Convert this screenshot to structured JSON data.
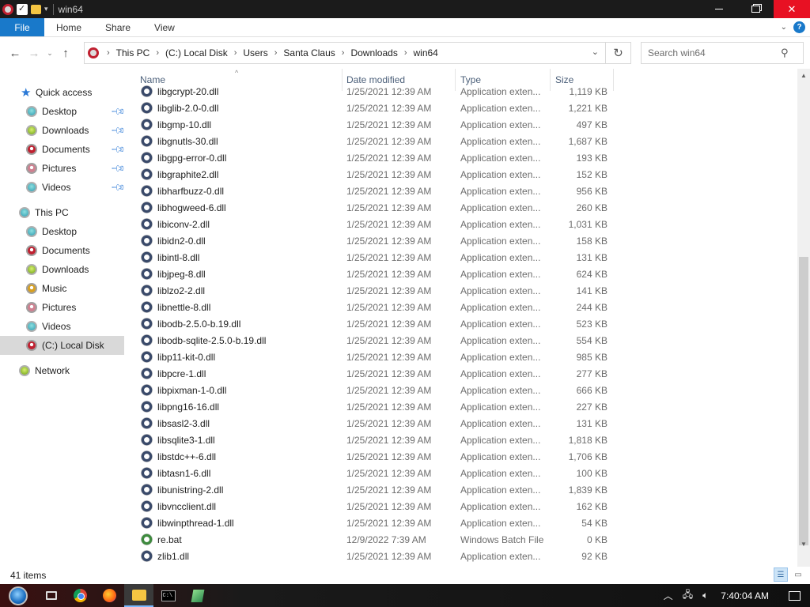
{
  "window": {
    "title": "win64"
  },
  "ribbon": {
    "tabs": [
      "File",
      "Home",
      "Share",
      "View"
    ]
  },
  "address": {
    "crumbs": [
      "This PC",
      "(C:) Local Disk",
      "Users",
      "Santa Claus",
      "Downloads",
      "win64"
    ]
  },
  "search": {
    "placeholder": "Search win64"
  },
  "nav": {
    "quick_access": "Quick access",
    "quick_items": [
      "Desktop",
      "Downloads",
      "Documents",
      "Pictures",
      "Videos"
    ],
    "this_pc": "This PC",
    "pc_items": [
      "Desktop",
      "Documents",
      "Downloads",
      "Music",
      "Pictures",
      "Videos",
      "(C:) Local Disk"
    ],
    "network": "Network"
  },
  "columns": {
    "name": "Name",
    "date": "Date modified",
    "type": "Type",
    "size": "Size"
  },
  "files": [
    {
      "name": "libgcrypt-20.dll",
      "date": "1/25/2021 12:39 AM",
      "type": "Application exten...",
      "size": "1,119 KB",
      "icon": "dll"
    },
    {
      "name": "libglib-2.0-0.dll",
      "date": "1/25/2021 12:39 AM",
      "type": "Application exten...",
      "size": "1,221 KB",
      "icon": "dll"
    },
    {
      "name": "libgmp-10.dll",
      "date": "1/25/2021 12:39 AM",
      "type": "Application exten...",
      "size": "497 KB",
      "icon": "dll"
    },
    {
      "name": "libgnutls-30.dll",
      "date": "1/25/2021 12:39 AM",
      "type": "Application exten...",
      "size": "1,687 KB",
      "icon": "dll"
    },
    {
      "name": "libgpg-error-0.dll",
      "date": "1/25/2021 12:39 AM",
      "type": "Application exten...",
      "size": "193 KB",
      "icon": "dll"
    },
    {
      "name": "libgraphite2.dll",
      "date": "1/25/2021 12:39 AM",
      "type": "Application exten...",
      "size": "152 KB",
      "icon": "dll"
    },
    {
      "name": "libharfbuzz-0.dll",
      "date": "1/25/2021 12:39 AM",
      "type": "Application exten...",
      "size": "956 KB",
      "icon": "dll"
    },
    {
      "name": "libhogweed-6.dll",
      "date": "1/25/2021 12:39 AM",
      "type": "Application exten...",
      "size": "260 KB",
      "icon": "dll"
    },
    {
      "name": "libiconv-2.dll",
      "date": "1/25/2021 12:39 AM",
      "type": "Application exten...",
      "size": "1,031 KB",
      "icon": "dll"
    },
    {
      "name": "libidn2-0.dll",
      "date": "1/25/2021 12:39 AM",
      "type": "Application exten...",
      "size": "158 KB",
      "icon": "dll"
    },
    {
      "name": "libintl-8.dll",
      "date": "1/25/2021 12:39 AM",
      "type": "Application exten...",
      "size": "131 KB",
      "icon": "dll"
    },
    {
      "name": "libjpeg-8.dll",
      "date": "1/25/2021 12:39 AM",
      "type": "Application exten...",
      "size": "624 KB",
      "icon": "dll"
    },
    {
      "name": "liblzo2-2.dll",
      "date": "1/25/2021 12:39 AM",
      "type": "Application exten...",
      "size": "141 KB",
      "icon": "dll"
    },
    {
      "name": "libnettle-8.dll",
      "date": "1/25/2021 12:39 AM",
      "type": "Application exten...",
      "size": "244 KB",
      "icon": "dll"
    },
    {
      "name": "libodb-2.5.0-b.19.dll",
      "date": "1/25/2021 12:39 AM",
      "type": "Application exten...",
      "size": "523 KB",
      "icon": "dll"
    },
    {
      "name": "libodb-sqlite-2.5.0-b.19.dll",
      "date": "1/25/2021 12:39 AM",
      "type": "Application exten...",
      "size": "554 KB",
      "icon": "dll"
    },
    {
      "name": "libp11-kit-0.dll",
      "date": "1/25/2021 12:39 AM",
      "type": "Application exten...",
      "size": "985 KB",
      "icon": "dll"
    },
    {
      "name": "libpcre-1.dll",
      "date": "1/25/2021 12:39 AM",
      "type": "Application exten...",
      "size": "277 KB",
      "icon": "dll"
    },
    {
      "name": "libpixman-1-0.dll",
      "date": "1/25/2021 12:39 AM",
      "type": "Application exten...",
      "size": "666 KB",
      "icon": "dll"
    },
    {
      "name": "libpng16-16.dll",
      "date": "1/25/2021 12:39 AM",
      "type": "Application exten...",
      "size": "227 KB",
      "icon": "dll"
    },
    {
      "name": "libsasl2-3.dll",
      "date": "1/25/2021 12:39 AM",
      "type": "Application exten...",
      "size": "131 KB",
      "icon": "dll"
    },
    {
      "name": "libsqlite3-1.dll",
      "date": "1/25/2021 12:39 AM",
      "type": "Application exten...",
      "size": "1,818 KB",
      "icon": "dll"
    },
    {
      "name": "libstdc++-6.dll",
      "date": "1/25/2021 12:39 AM",
      "type": "Application exten...",
      "size": "1,706 KB",
      "icon": "dll"
    },
    {
      "name": "libtasn1-6.dll",
      "date": "1/25/2021 12:39 AM",
      "type": "Application exten...",
      "size": "100 KB",
      "icon": "dll"
    },
    {
      "name": "libunistring-2.dll",
      "date": "1/25/2021 12:39 AM",
      "type": "Application exten...",
      "size": "1,839 KB",
      "icon": "dll"
    },
    {
      "name": "libvncclient.dll",
      "date": "1/25/2021 12:39 AM",
      "type": "Application exten...",
      "size": "162 KB",
      "icon": "dll"
    },
    {
      "name": "libwinpthread-1.dll",
      "date": "1/25/2021 12:39 AM",
      "type": "Application exten...",
      "size": "54 KB",
      "icon": "dll"
    },
    {
      "name": "re.bat",
      "date": "12/9/2022 7:39 AM",
      "type": "Windows Batch File",
      "size": "0 KB",
      "icon": "bat"
    },
    {
      "name": "zlib1.dll",
      "date": "1/25/2021 12:39 AM",
      "type": "Application exten...",
      "size": "92 KB",
      "icon": "dll"
    }
  ],
  "status": {
    "count": "41 items"
  },
  "taskbar": {
    "time": "7:40:04 AM",
    "cmd_label": "C:\\"
  },
  "colors": {
    "accent": "#1979ca",
    "close": "#e81123",
    "selected": "#d9d9d9"
  }
}
